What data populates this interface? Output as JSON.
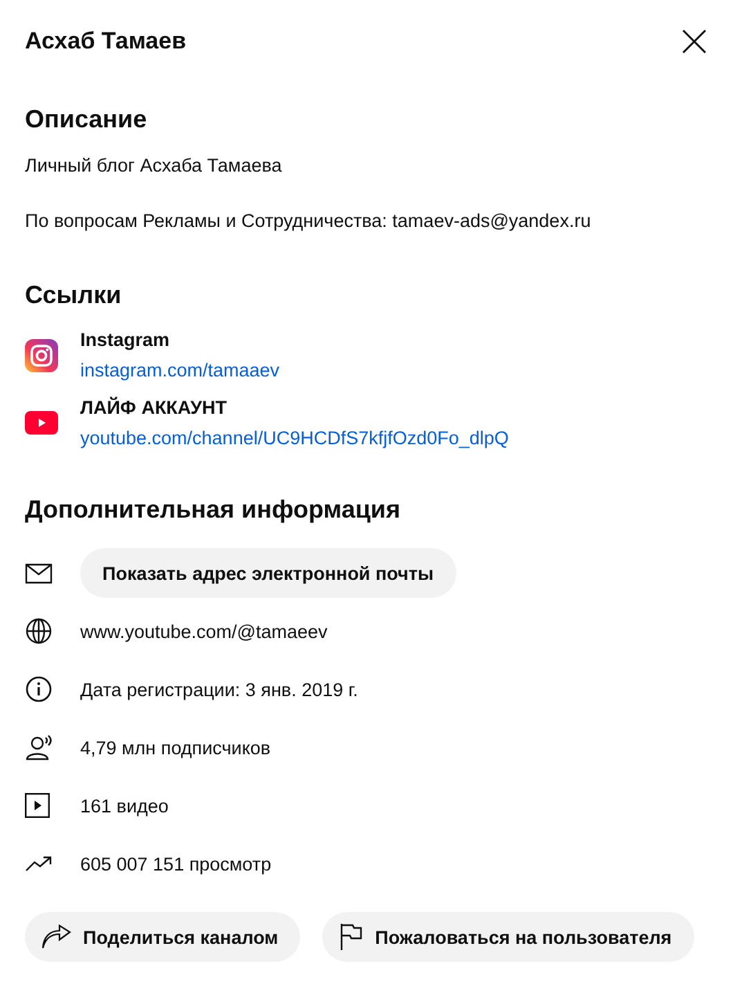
{
  "title": "Асхаб Тамаев",
  "description": {
    "heading": "Описание",
    "paragraphs": [
      "Личный блог Асхаба Тамаева",
      "По вопросам Рекламы и Сотрудничества: tamaev-ads@yandex.ru"
    ]
  },
  "links": {
    "heading": "Ссылки",
    "items": [
      {
        "kind": "instagram",
        "title": "Instagram",
        "url": "instagram.com/tamaaev"
      },
      {
        "kind": "youtube",
        "title": "ЛАЙФ АККАУНТ",
        "url": "youtube.com/channel/UC9HCDfS7kfjfOzd0Fo_dlpQ"
      }
    ]
  },
  "details": {
    "heading": "Дополнительная информация",
    "rows": [
      {
        "kind": "email",
        "button": "Показать адрес электронной почты"
      },
      {
        "kind": "globe",
        "text": "www.youtube.com/@tamaeev"
      },
      {
        "kind": "info",
        "text": "Дата регистрации: 3 янв. 2019 г."
      },
      {
        "kind": "subscribers",
        "text": "4,79 млн подписчиков"
      },
      {
        "kind": "video",
        "text": "161 видео"
      },
      {
        "kind": "views",
        "text": "605 007 151 просмотр"
      }
    ]
  },
  "actions": [
    {
      "kind": "share",
      "label": "Поделиться каналом"
    },
    {
      "kind": "report",
      "label": "Пожаловаться на пользователя"
    }
  ]
}
